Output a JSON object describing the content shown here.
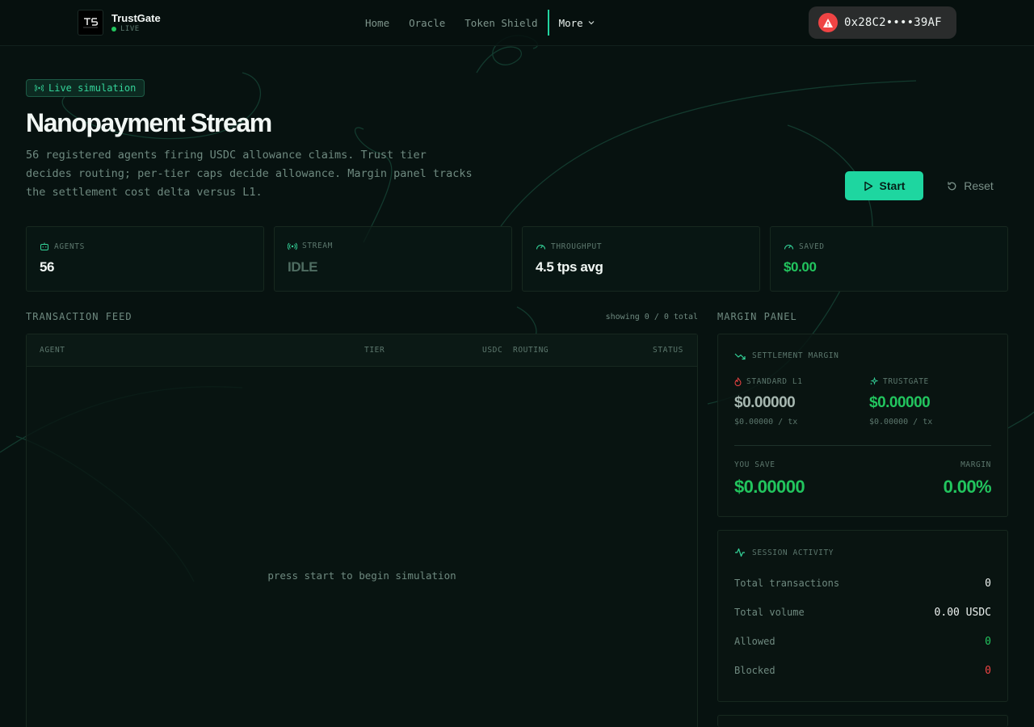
{
  "app": {
    "brand": "TrustGate",
    "brand_status": "LIVE"
  },
  "nav": {
    "links": [
      "Home",
      "Oracle",
      "Token Shield"
    ],
    "more": "More"
  },
  "wallet": {
    "address": "0x28C2••••39AF",
    "status_color": "#ef4444"
  },
  "hero": {
    "pill": "Live simulation",
    "title": "Nanopayment Stream",
    "subtitle": "56 registered agents firing USDC allowance claims. Trust tier decides routing; per-tier caps decide allowance. Margin panel tracks the settlement cost delta versus L1."
  },
  "actions": {
    "start": "Start",
    "reset": "Reset"
  },
  "stats": [
    {
      "label": "AGENTS",
      "value": "56",
      "icon": "bot-icon",
      "color": "#f1f7f4"
    },
    {
      "label": "STREAM",
      "value": "IDLE",
      "icon": "radio-icon",
      "color": "#4f6d62"
    },
    {
      "label": "THROUGHPUT",
      "value": "4.5 tps avg",
      "icon": "gauge-icon",
      "color": "#f1f7f4"
    },
    {
      "label": "SAVED",
      "value": "$0.00",
      "icon": "gauge-icon",
      "color": "#22c55e"
    }
  ],
  "feed": {
    "section_label": "TRANSACTION FEED",
    "showing": "showing 0 / 0 total",
    "columns": [
      "AGENT",
      "TIER",
      "USDC",
      "ROUTING",
      "STATUS"
    ],
    "empty_message": "press start to begin simulation"
  },
  "margin": {
    "section_label": "MARGIN PANEL",
    "title": "SETTLEMENT MARGIN",
    "standard": {
      "label": "STANDARD L1",
      "value": "$0.00000",
      "per_tx": "$0.00000 / tx"
    },
    "trustgate": {
      "label": "TRUSTGATE",
      "value": "$0.00000",
      "per_tx": "$0.00000 / tx"
    },
    "you_save_label": "YOU SAVE",
    "you_save_value": "$0.00000",
    "margin_label": "MARGIN",
    "margin_value": "0.00%"
  },
  "session": {
    "title": "SESSION ACTIVITY",
    "rows": [
      {
        "label": "Total transactions",
        "value": "0",
        "color": "#eef3f1"
      },
      {
        "label": "Total volume",
        "value": "0.00 USDC",
        "color": "#eef3f1"
      },
      {
        "label": "Allowed",
        "value": "0",
        "color": "#22c55e"
      },
      {
        "label": "Blocked",
        "value": "0",
        "color": "#ef4444"
      }
    ]
  },
  "colors": {
    "accent": "#1ed6a0",
    "success": "#22c55e",
    "danger": "#ef4444",
    "background": "#071210"
  }
}
